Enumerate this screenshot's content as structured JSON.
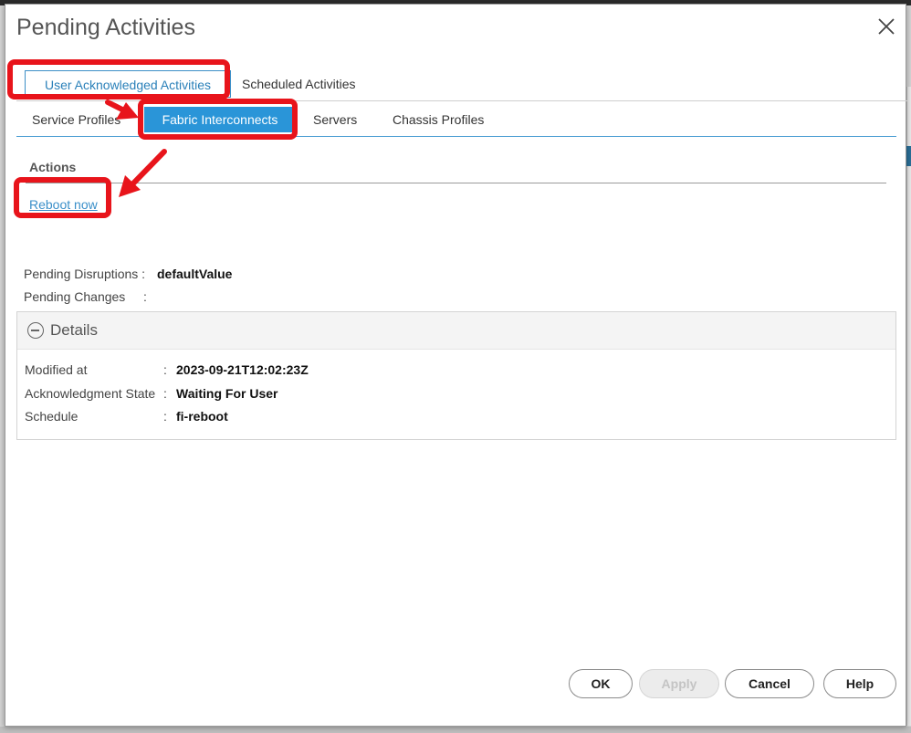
{
  "dialog": {
    "title": "Pending Activities"
  },
  "tabs_primary": [
    {
      "label": "User Acknowledged Activities",
      "active": true
    },
    {
      "label": "Scheduled Activities",
      "active": false
    }
  ],
  "tabs_secondary": [
    {
      "label": "Service Profiles",
      "active": false
    },
    {
      "label": "Fabric Interconnects",
      "active": true
    },
    {
      "label": "Servers",
      "active": false
    },
    {
      "label": "Chassis Profiles",
      "active": false
    }
  ],
  "actions": {
    "heading": "Actions",
    "reboot_label": "Reboot now"
  },
  "pending": {
    "disruptions_label": "Pending Disruptions :",
    "disruptions_value": "defaultValue",
    "changes_label": "Pending Changes",
    "changes_colon": ":"
  },
  "details": {
    "title": "Details",
    "rows": [
      {
        "label": "Modified at",
        "colon": ":",
        "value": "2023-09-21T12:02:23Z"
      },
      {
        "label": "Acknowledgment State",
        "colon": ":",
        "value": "Waiting For User"
      },
      {
        "label": "Schedule",
        "colon": ":",
        "value": "fi-reboot"
      }
    ]
  },
  "footer": {
    "ok": "OK",
    "apply": "Apply",
    "cancel": "Cancel",
    "help": "Help"
  },
  "colors": {
    "accent": "#2a95d8",
    "annotation": "#e8141b",
    "link": "#3a8fc9"
  }
}
